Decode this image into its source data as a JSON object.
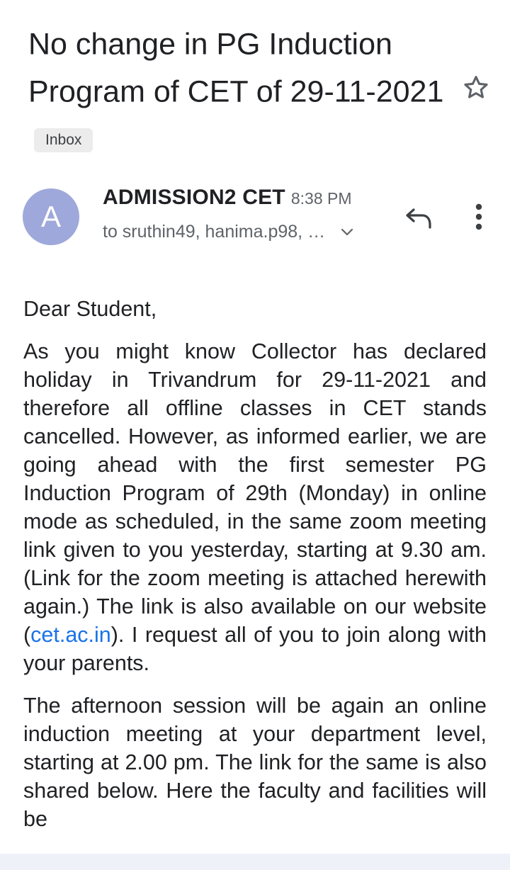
{
  "email": {
    "subject": "No change in PG Induction Program of CET of 29-11-2021",
    "label": "Inbox",
    "sender": {
      "avatar_letter": "A",
      "name": "ADMISSION2 CET",
      "time": "8:38 PM",
      "recipients": "to sruthin49, hanima.p98, …"
    },
    "body": {
      "greeting": "Dear Student,",
      "para1_before_link": "As you might know Collector has declared holiday in Trivandrum for 29-11-2021 and therefore all offline classes in CET stands cancelled. However, as informed earlier, we are going ahead with the first semester PG Induction Program of 29th (Monday) in online mode as scheduled, in the same zoom meeting link given to you yesterday, starting at 9.30 am. (Link for the zoom meeting is attached herewith again.) The link is also available on our website (",
      "link_text": "cet.ac.in",
      "para1_after_link": "). I request all of you to join along with your parents.",
      "para2": "The afternoon session will be again an online induction meeting at your department level, starting at 2.00 pm. The link for the same is also shared below. Here the faculty and facilities will be"
    }
  },
  "icons": {
    "star": "star-outline-icon",
    "reply": "reply-arrow-icon",
    "more": "more-vertical-icon",
    "expand": "chevron-down-icon"
  },
  "colors": {
    "avatar_bg": "#9fa8da",
    "link": "#1a73e8",
    "chip_bg": "#ececec",
    "secondary_text": "#5f6368"
  }
}
